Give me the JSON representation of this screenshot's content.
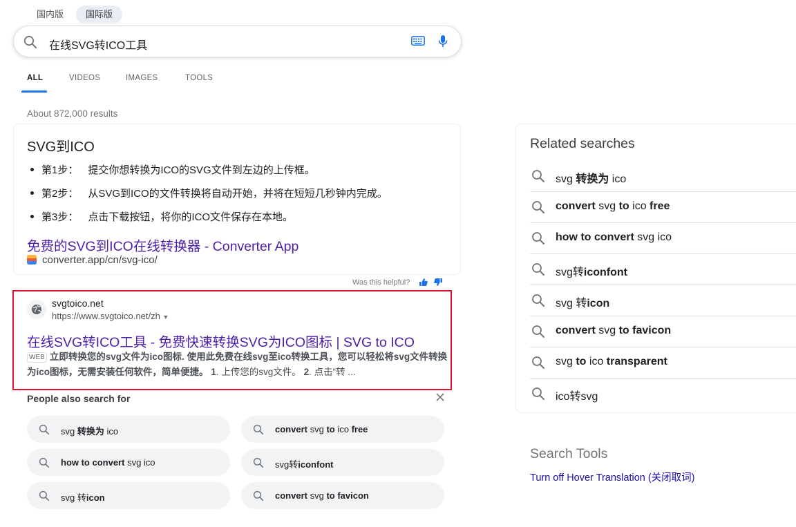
{
  "region_tabs": [
    {
      "label": "国内版",
      "active": false
    },
    {
      "label": "国际版",
      "active": true
    }
  ],
  "search": {
    "query": "在线SVG转ICO工具"
  },
  "nav_tabs": [
    {
      "label": "ALL",
      "active": true
    },
    {
      "label": "VIDEOS",
      "active": false
    },
    {
      "label": "IMAGES",
      "active": false
    },
    {
      "label": "TOOLS",
      "active": false
    }
  ],
  "results_count": "About 872,000 results",
  "featured_snippet": {
    "title": "SVG到ICO",
    "steps": [
      {
        "label": "第1步：",
        "text": "提交你想转换为ICO的SVG文件到左边的上传框。"
      },
      {
        "label": "第2步：",
        "text": "从SVG到ICO的文件转换将自动开始，并将在短短几秒钟内完成。"
      },
      {
        "label": "第3步：",
        "text": "点击下载按钮，将你的ICO文件保存在本地。"
      }
    ],
    "link_title": "免费的SVG到ICO在线转换器 - Converter App",
    "url": "converter.app/cn/svg-ico/",
    "helpful_text": "Was this helpful?"
  },
  "result": {
    "site_name": "svgtoico.net",
    "url": "https://www.svgtoico.net/zh",
    "title": "在线SVG转ICO工具 - 免费快速转换SVG为ICO图标 | SVG to ICO",
    "badge": "WEB",
    "desc_bold": "立即转换您的svg文件为ico图标",
    "desc_mid": ". 使用此免费在线svg至ico转换工具，您可以轻松将svg文件转换为ico图标，无需安装任何软件，简单便捷。",
    "desc_tail_num1": "1",
    "desc_tail_1": ". 上传您的svg文件。",
    "desc_tail_num2": "2",
    "desc_tail_2": ". 点击“转 ..."
  },
  "people_also_search": {
    "title": "People also search for",
    "chips": [
      {
        "parts": [
          {
            "t": "svg ",
            "b": false
          },
          {
            "t": "转换为",
            "b": true
          },
          {
            "t": " ico",
            "b": false
          }
        ]
      },
      {
        "parts": [
          {
            "t": "convert",
            "b": true
          },
          {
            "t": " svg ",
            "b": false
          },
          {
            "t": "to",
            "b": true
          },
          {
            "t": " ico ",
            "b": false
          },
          {
            "t": "free",
            "b": true
          }
        ]
      },
      {
        "parts": [
          {
            "t": "how to convert",
            "b": true
          },
          {
            "t": " svg ico",
            "b": false
          }
        ]
      },
      {
        "parts": [
          {
            "t": "svg转",
            "b": false
          },
          {
            "t": "iconfont",
            "b": true
          }
        ]
      },
      {
        "parts": [
          {
            "t": "svg ",
            "b": false
          },
          {
            "t": "转",
            "b": false
          },
          {
            "t": "icon",
            "b": true
          }
        ]
      },
      {
        "parts": [
          {
            "t": "convert",
            "b": true
          },
          {
            "t": " svg ",
            "b": false
          },
          {
            "t": "to favicon",
            "b": true
          }
        ]
      }
    ]
  },
  "related_searches": {
    "title": "Related searches",
    "items": [
      {
        "parts": [
          {
            "t": "svg ",
            "b": false
          },
          {
            "t": "转换为",
            "b": true
          },
          {
            "t": " ico",
            "b": false
          }
        ]
      },
      {
        "parts": [
          {
            "t": "convert",
            "b": true
          },
          {
            "t": " svg ",
            "b": false
          },
          {
            "t": "to",
            "b": true
          },
          {
            "t": " ico ",
            "b": false
          },
          {
            "t": "free",
            "b": true
          }
        ]
      },
      {
        "parts": [
          {
            "t": "how to convert",
            "b": true
          },
          {
            "t": " svg ico",
            "b": false
          }
        ]
      },
      {
        "parts": [
          {
            "t": "svg转",
            "b": false
          },
          {
            "t": "iconfont",
            "b": true
          }
        ]
      },
      {
        "parts": [
          {
            "t": "svg ",
            "b": false
          },
          {
            "t": "转",
            "b": false
          },
          {
            "t": "icon",
            "b": true
          }
        ]
      },
      {
        "parts": [
          {
            "t": "convert",
            "b": true
          },
          {
            "t": " svg ",
            "b": false
          },
          {
            "t": "to favicon",
            "b": true
          }
        ]
      },
      {
        "parts": [
          {
            "t": "svg ",
            "b": false
          },
          {
            "t": "to",
            "b": true
          },
          {
            "t": " ico ",
            "b": false
          },
          {
            "t": "transparent",
            "b": true
          }
        ]
      },
      {
        "parts": [
          {
            "t": "ico转svg",
            "b": false
          }
        ]
      }
    ]
  },
  "search_tools": {
    "title": "Search Tools",
    "link": "Turn off Hover Translation (关闭取词)"
  },
  "colors": {
    "link_visited": "#4c1fa8",
    "link": "#1a0dab",
    "accent": "#1a73e8",
    "highlight_border": "#e0112d"
  }
}
